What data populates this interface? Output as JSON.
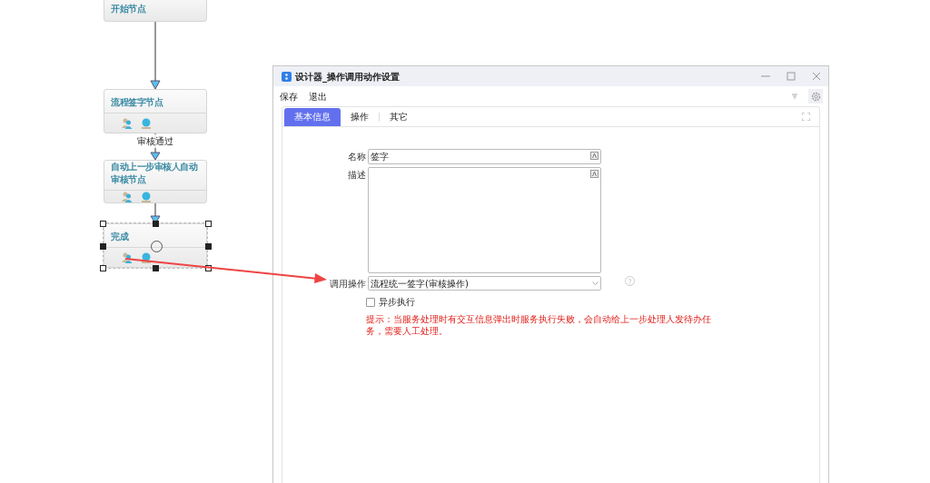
{
  "flow": {
    "nodes": [
      {
        "title": "开始节点",
        "kind": "start",
        "selected": false
      },
      {
        "title": "流程签字节点",
        "kind": "task",
        "selected": false
      },
      {
        "title": "自动上一步审核人自动审核节点",
        "kind": "task",
        "selected": false
      },
      {
        "title": "完成",
        "kind": "end",
        "selected": true
      }
    ],
    "edge_labels": [
      "审核通过"
    ]
  },
  "dialog": {
    "title": "设计器_操作调用动作设置",
    "menu": [
      "保存",
      "退出"
    ],
    "tabs": [
      {
        "label": "基本信息",
        "selected": true
      },
      {
        "label": "操作",
        "selected": false
      },
      {
        "label": "其它",
        "selected": false
      }
    ],
    "fields": [
      {
        "label": "名称",
        "kind": "text",
        "value": "签字"
      },
      {
        "label": "描述",
        "kind": "textarea"
      },
      {
        "label": "调用操作",
        "kind": "select",
        "value": "流程统一签字(审核操作)"
      }
    ],
    "async": {
      "label": "异步执行",
      "checked": false
    },
    "hint": "提示：当服务处理时有交互信息弹出时服务执行失败，会自动给上一步处理人发待办任务，需要人工处理。"
  }
}
